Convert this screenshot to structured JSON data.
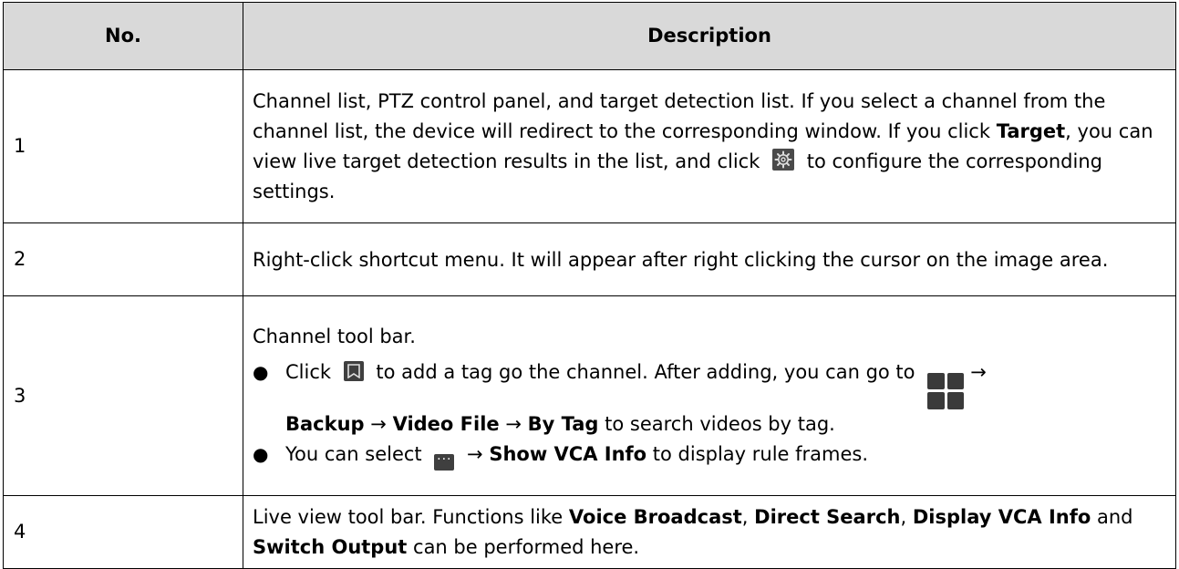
{
  "table": {
    "headers": {
      "no": "No.",
      "description": "Description"
    },
    "rows": [
      {
        "no": "1",
        "text_1": "Channel list, PTZ control panel, and target detection list. If you select a channel from the channel list, the device will redirect to the corresponding window. If you click ",
        "bold_1": "Target",
        "text_2": ", you can view live target detection results in the list, and click ",
        "icon": "gear-icon",
        "text_3": " to configure the corresponding settings."
      },
      {
        "no": "2",
        "text": "Right-click shortcut menu. It will appear after right clicking the cursor on the image area."
      },
      {
        "no": "3",
        "intro": "Channel tool bar.",
        "bullet_1": {
          "text_1": "Click ",
          "icon_1": "tag-icon",
          "text_2": " to add a tag go the channel. After adding, you can go to ",
          "icon_2": "main-menu-grid-icon",
          "arrow": "→",
          "bold_1": "Backup",
          "bold_2": "Video File",
          "bold_3": "By Tag",
          "text_3": " to search videos by tag."
        },
        "bullet_2": {
          "text_1": "You can select ",
          "icon": "more-icon",
          "bold_1": "Show VCA Info",
          "text_2": " to display rule frames."
        }
      },
      {
        "no": "4",
        "text_1": "Live view tool bar. Functions like ",
        "bold_1": "Voice Broadcast",
        "sep_1": ", ",
        "bold_2": "Direct Search",
        "sep_2": ", ",
        "bold_3": "Display VCA Info",
        "text_2": " and ",
        "bold_4": "Switch Output",
        "text_3": " can be performed here."
      }
    ]
  }
}
